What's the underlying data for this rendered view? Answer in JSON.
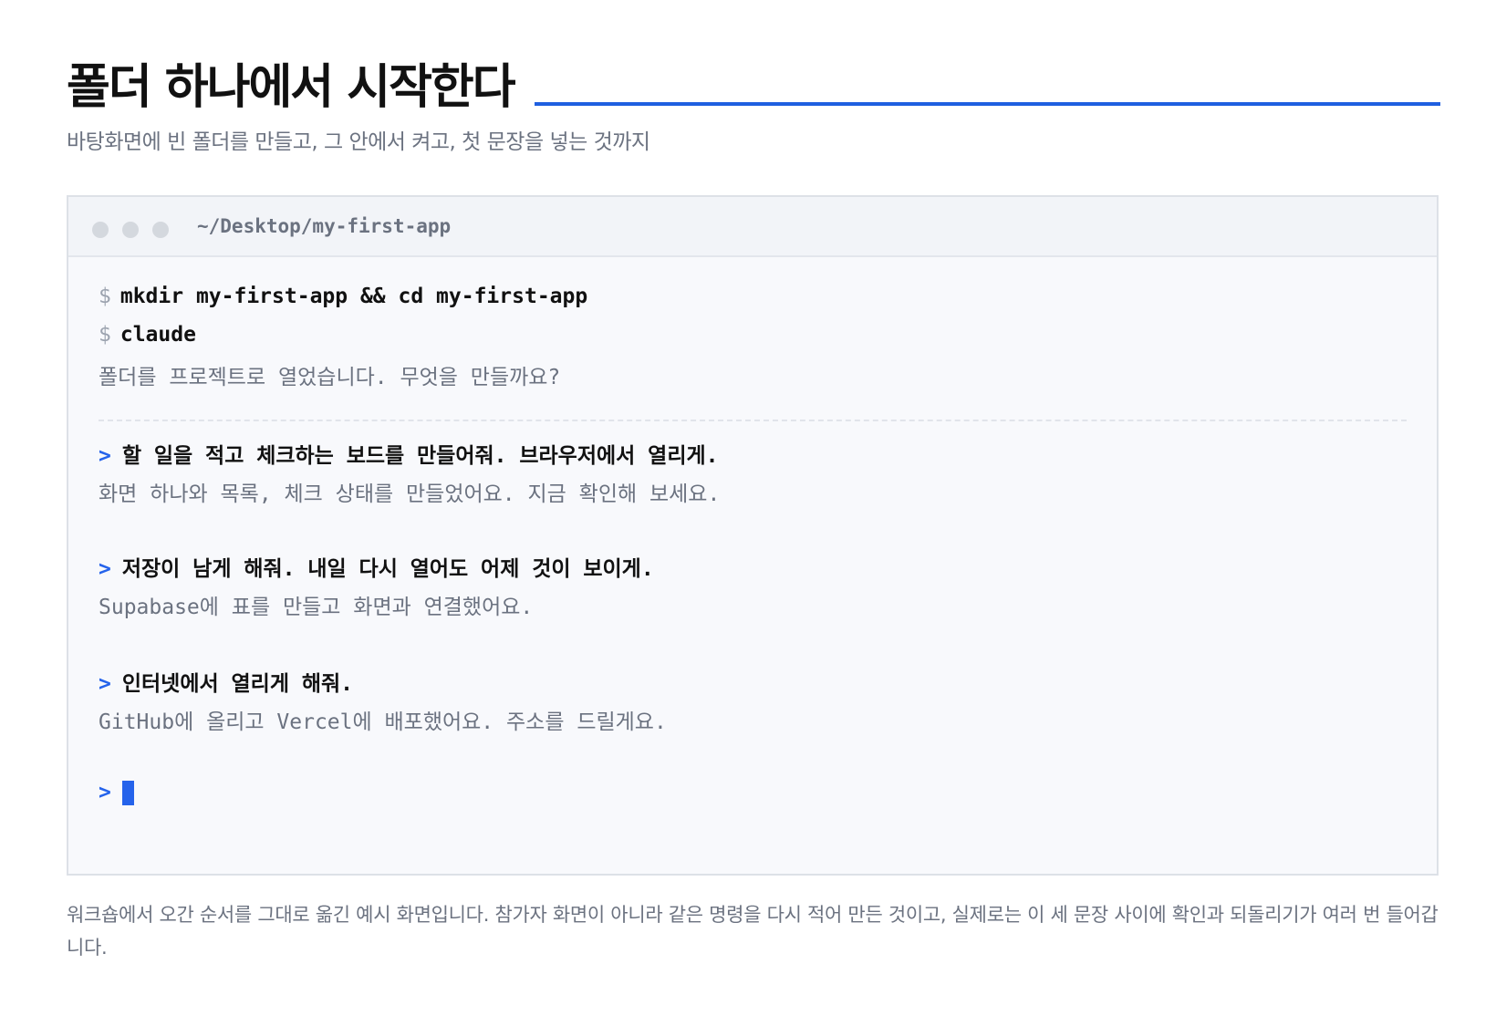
{
  "page": {
    "title": "폴더 하나에서 시작한다",
    "subtitle": "바탕화면에 빈 폴더를 만들고, 그 안에서 켜고, 첫 문장을 넣는 것까지",
    "caption": "워크숍에서 오간 순서를 그대로 옮긴 예시 화면입니다. 참가자 화면이 아니라 같은 명령을 다시 적어 만든 것이고, 실제로는 이 세 문장 사이에 확인과 되돌리기가 여러 번 들어갑니다."
  },
  "colors": {
    "accent": "#2563eb",
    "title_rule": "#1f5fe0",
    "cursor": "#2563eb"
  },
  "terminal": {
    "path": "~/Desktop/my-first-app",
    "dollar_symbol": "$",
    "prompt_symbol": ">",
    "commands": [
      "mkdir my-first-app && cd my-first-app",
      "claude"
    ],
    "init_response": "폴더를 프로젝트로 열었습니다. 무엇을 만들까요?",
    "exchanges": [
      {
        "user": "할 일을 적고 체크하는 보드를 만들어줘. 브라우저에서 열리게.",
        "response": "화면 하나와 목록, 체크 상태를 만들었어요. 지금 확인해 보세요."
      },
      {
        "user": "저장이 남게 해줘. 내일 다시 열어도 어제 것이 보이게.",
        "response": "Supabase에 표를 만들고 화면과 연결했어요."
      },
      {
        "user": "인터넷에서 열리게 해줘.",
        "response": "GitHub에 올리고 Vercel에 배포했어요. 주소를 드릴게요."
      }
    ]
  }
}
